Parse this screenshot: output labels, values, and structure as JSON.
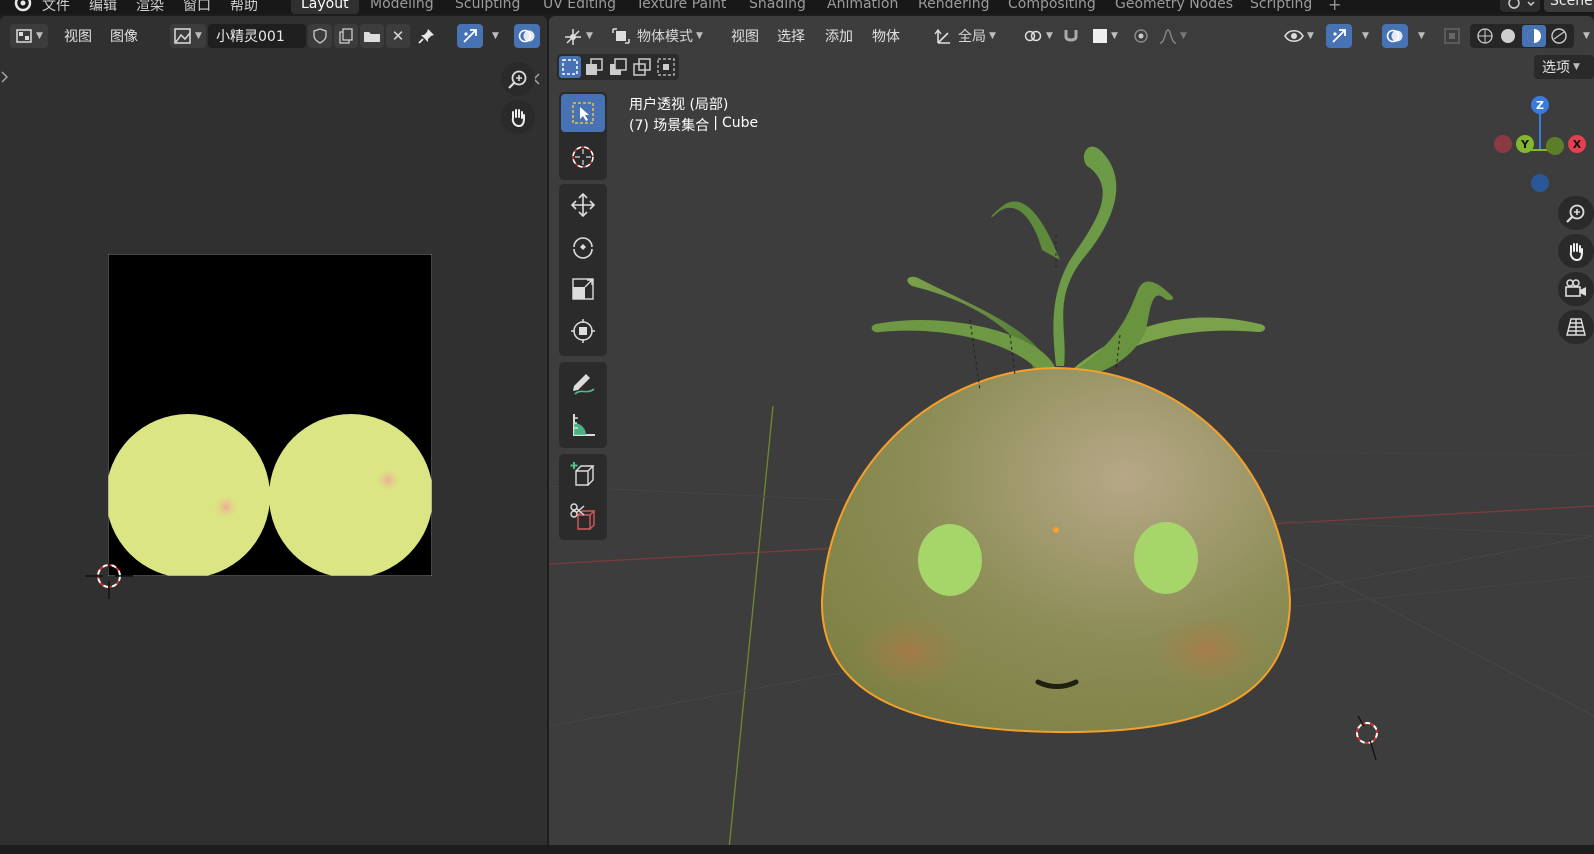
{
  "menubar": {
    "items": [
      "文件",
      "编辑",
      "渲染",
      "窗口",
      "帮助"
    ],
    "workspaces": [
      "Layout",
      "Modeling",
      "Sculpting",
      "UV Editing",
      "Texture Paint",
      "Shading",
      "Animation",
      "Rendering",
      "Compositing",
      "Geometry Nodes",
      "Scripting"
    ],
    "active_workspace": "Layout",
    "add_tab": "+",
    "scene_label": "Scene"
  },
  "image_editor": {
    "menu_view": "视图",
    "menu_image": "图像",
    "image_name": "小精灵001",
    "close_glyph": "✕"
  },
  "viewport": {
    "mode_label": "物体模式",
    "menu_view": "视图",
    "menu_select": "选择",
    "menu_add": "添加",
    "menu_object": "物体",
    "transform_orientation": "全局",
    "options_label": "选项",
    "overlay_line1": "用户透视 (局部)",
    "overlay_line2_prefix": "(7) 场景集合",
    "overlay_line2_sep": "|",
    "overlay_line2_object": "Cube",
    "gizmo": {
      "z": "Z",
      "y": "Y",
      "x": "X"
    }
  },
  "colors": {
    "accent_blue": "#4772b3",
    "panel_bg": "#303030",
    "selection_orange": "#f5a02a",
    "axis_x": "#e2404f",
    "axis_y": "#82b82f",
    "axis_z": "#3a7be0"
  }
}
